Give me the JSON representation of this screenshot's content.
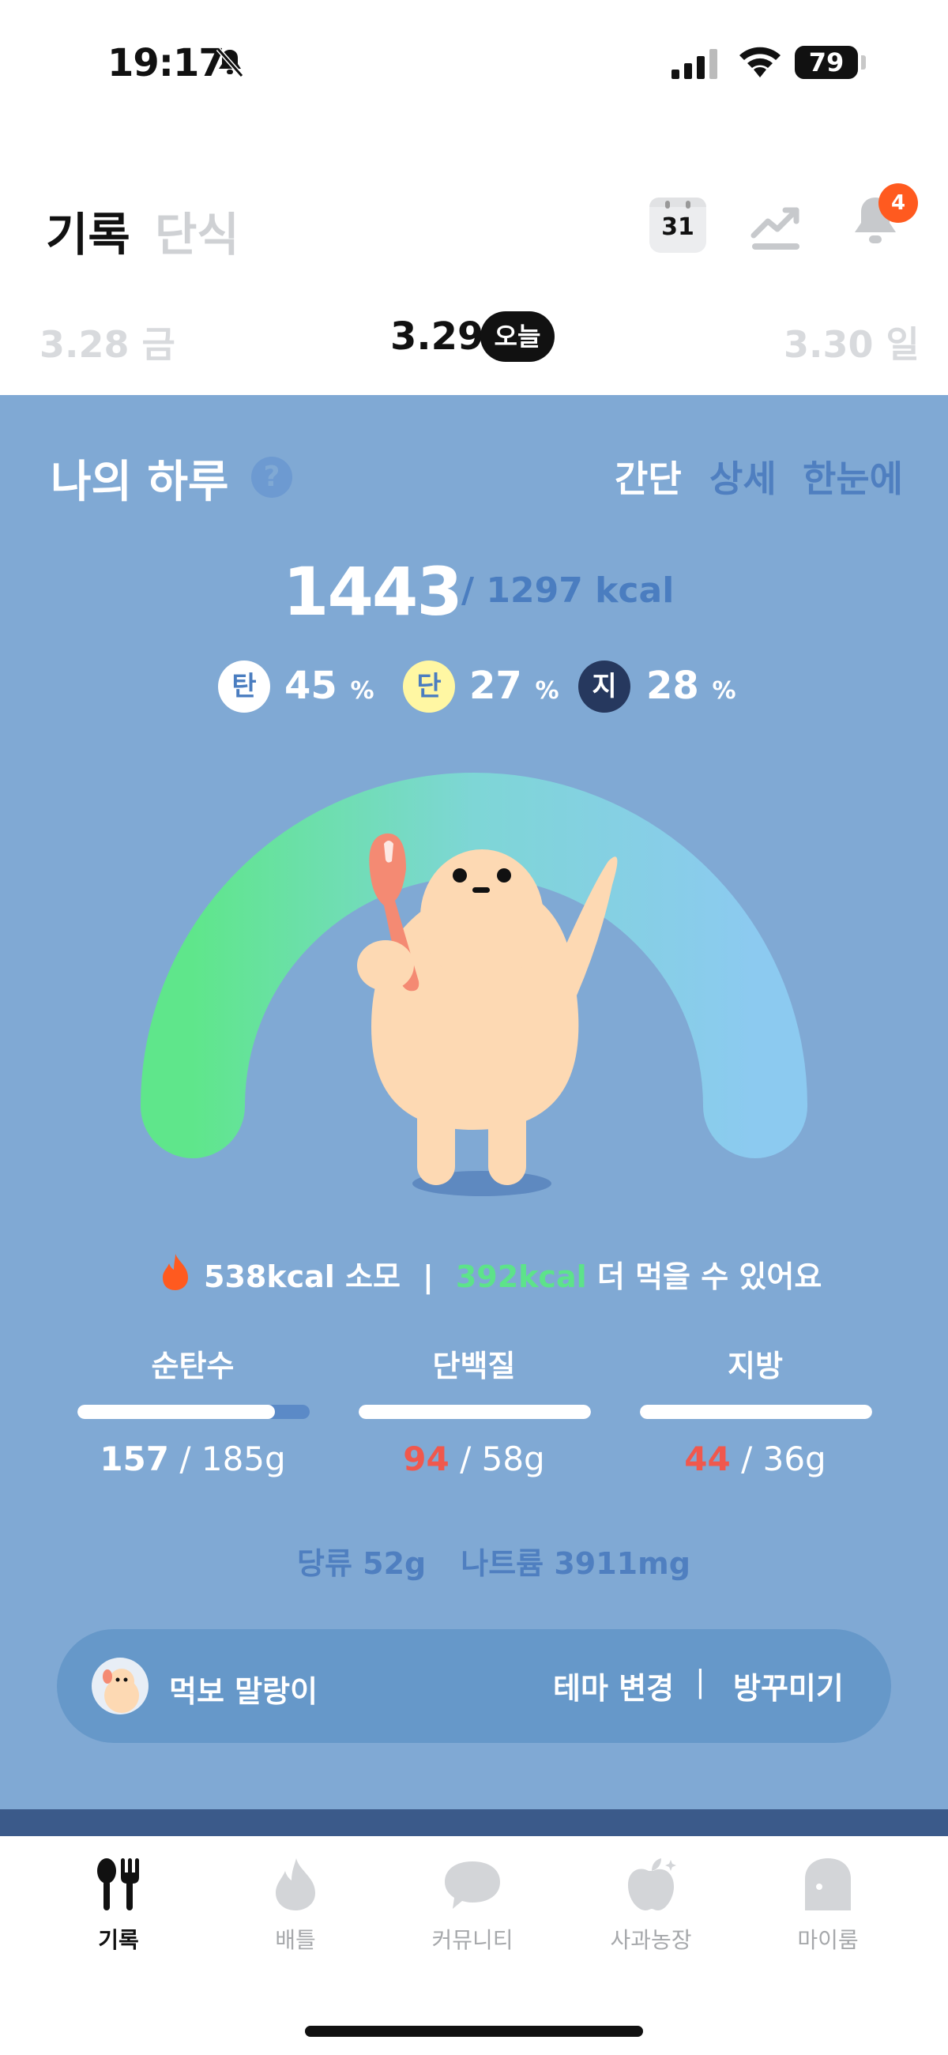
{
  "status_bar": {
    "time": "19:17",
    "battery": "79"
  },
  "header": {
    "tabs": [
      {
        "label": "기록",
        "active": true
      },
      {
        "label": "단식",
        "active": false
      }
    ],
    "calendar_day": "31",
    "notification_count": "4"
  },
  "date_nav": {
    "prev": "3.28 금",
    "current": "3.29",
    "today_label": "오늘",
    "next": "3.30 일"
  },
  "summary": {
    "title": "나의 하루",
    "help": "?",
    "view_options": [
      "간단",
      "상세",
      "한눈에"
    ],
    "kcal_eaten": "1443",
    "kcal_goal": "/ 1297 kcal",
    "macros": [
      {
        "badge": "탄",
        "percent": "45",
        "unit": "%"
      },
      {
        "badge": "단",
        "percent": "27",
        "unit": "%"
      },
      {
        "badge": "지",
        "percent": "28",
        "unit": "%"
      }
    ],
    "burn": {
      "value": "538kcal",
      "label": "소모",
      "separator": "|",
      "remain": "392kcal",
      "remain_label": "더 먹을 수 있어요"
    },
    "nutrients": [
      {
        "label": "순탄수",
        "eaten": "157",
        "goal": "/ 185g",
        "over": false,
        "fill": 0.85
      },
      {
        "label": "단백질",
        "eaten": "94",
        "goal": "/ 58g",
        "over": true,
        "fill": 1.0
      },
      {
        "label": "지방",
        "eaten": "44",
        "goal": "/ 36g",
        "over": true,
        "fill": 1.0
      }
    ],
    "extras": [
      "당류 52g",
      "나트륨 3911mg"
    ]
  },
  "theme": {
    "name": "먹보 말랑이",
    "change": "테마 변경",
    "separator": "|",
    "decorate": "방꾸미기"
  },
  "nav": [
    {
      "label": "기록",
      "icon": "utensils-icon",
      "active": true
    },
    {
      "label": "배틀",
      "icon": "flame-icon",
      "active": false
    },
    {
      "label": "커뮤니티",
      "icon": "chat-bubble-icon",
      "active": false
    },
    {
      "label": "사과농장",
      "icon": "apple-icon",
      "active": false
    },
    {
      "label": "마이룸",
      "icon": "door-icon",
      "active": false
    }
  ],
  "colors": {
    "card": "#80a9d4",
    "accent_orange": "#ff5a1f",
    "green": "#5de38a",
    "over": "#f0584d"
  }
}
